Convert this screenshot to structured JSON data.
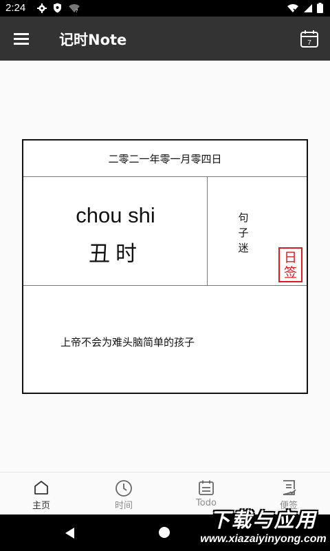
{
  "status_bar": {
    "time": "2:24"
  },
  "app_bar": {
    "title": "记时Note",
    "calendar_day": "7"
  },
  "card": {
    "date": "二零二一年零一月零四日",
    "pinyin": "chou shi",
    "hour": "丑时",
    "source": [
      "句",
      "子",
      "迷"
    ],
    "seal": [
      "日",
      "签"
    ],
    "quote": "上帝不会为难头脑简单的孩子"
  },
  "bottom_nav": {
    "items": [
      {
        "label": "主页",
        "icon": "home-icon"
      },
      {
        "label": "时间",
        "icon": "clock-icon"
      },
      {
        "label": "Todo",
        "icon": "todo-calendar-icon"
      },
      {
        "label": "便签",
        "icon": "note-check-icon"
      }
    ]
  },
  "watermark": {
    "main": "下载与应用",
    "sub": "www.xiazaiyinyong.com"
  },
  "colors": {
    "app_bar": "#333333",
    "seal": "#e0191f",
    "background": "#fafafa"
  }
}
